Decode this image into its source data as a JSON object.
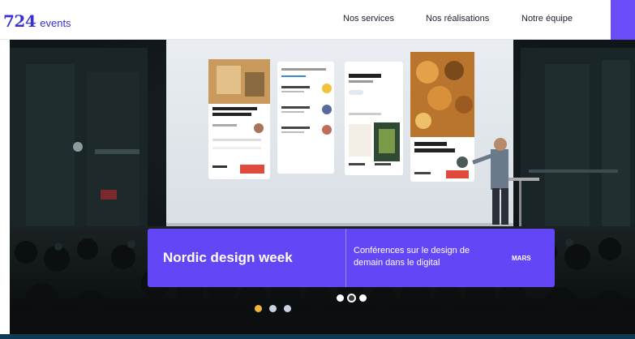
{
  "brand": {
    "number": "724",
    "word": "events",
    "accent": "#3a2fd1"
  },
  "nav": {
    "items": [
      {
        "label": "Nos services"
      },
      {
        "label": "Nos réalisations"
      },
      {
        "label": "Notre équipe"
      }
    ]
  },
  "slide": {
    "title": "Nordic design week",
    "description": "Conférences sur le design de demain dans le digital",
    "month": "MARS",
    "card_color": "#6346f5"
  },
  "screen": {
    "card1_title": "Left with Open Floor Plan and Kitchen",
    "card2_title": "Los Angeles",
    "card3_title": "Pop-up Restaurant Tour",
    "card2_book_title": "TEN EXPLORERS"
  },
  "carousel": {
    "active_index": 0,
    "count": 3,
    "alt_active_index": 1,
    "alt_count": 3
  }
}
